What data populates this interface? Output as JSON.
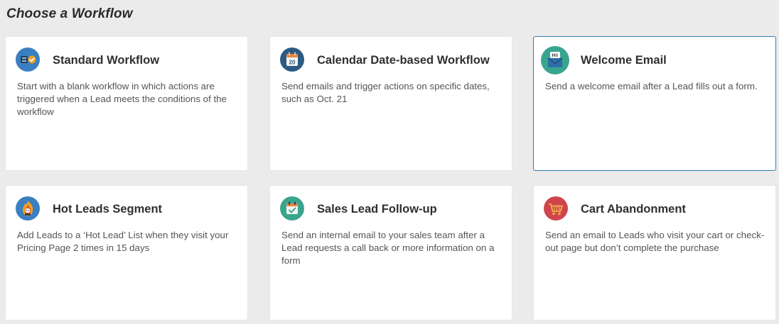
{
  "page": {
    "title": "Choose a Workflow"
  },
  "colors": {
    "background": "#ebebeb",
    "selected_border": "#2e7fb0",
    "icon_blue": "#3a7fc1",
    "icon_navy": "#2d5a82",
    "icon_teal": "#3aa58f",
    "icon_red": "#d0454d"
  },
  "workflows": [
    {
      "title": "Standard Workflow",
      "description": "Start with a blank workflow in which actions are triggered when a Lead meets the conditions of the workflow",
      "icon": "standard-workflow-icon",
      "selected": false
    },
    {
      "title": "Calendar Date-based Workflow",
      "description": "Send emails and trigger actions on specific dates, such as Oct. 21",
      "icon": "calendar-icon",
      "icon_text": "20",
      "selected": false
    },
    {
      "title": "Welcome Email",
      "description": "Send a welcome email after a Lead fills out a form.",
      "icon": "welcome-email-icon",
      "icon_text": "Hi!",
      "selected": true
    },
    {
      "title": "Hot Leads Segment",
      "description": "Add Leads to a ‘Hot Lead’ List when they visit your Pricing Page 2 times in 15 days",
      "icon": "hot-lead-icon",
      "selected": false
    },
    {
      "title": "Sales Lead Follow-up",
      "description": "Send an internal email to your sales team after a Lead requests a call back or more information on a form",
      "icon": "calendar-check-icon",
      "selected": false
    },
    {
      "title": "Cart Abandonment",
      "description": "Send an email to Leads who visit your cart or check-out page but don’t complete the purchase",
      "icon": "shopping-cart-icon",
      "selected": false
    }
  ]
}
